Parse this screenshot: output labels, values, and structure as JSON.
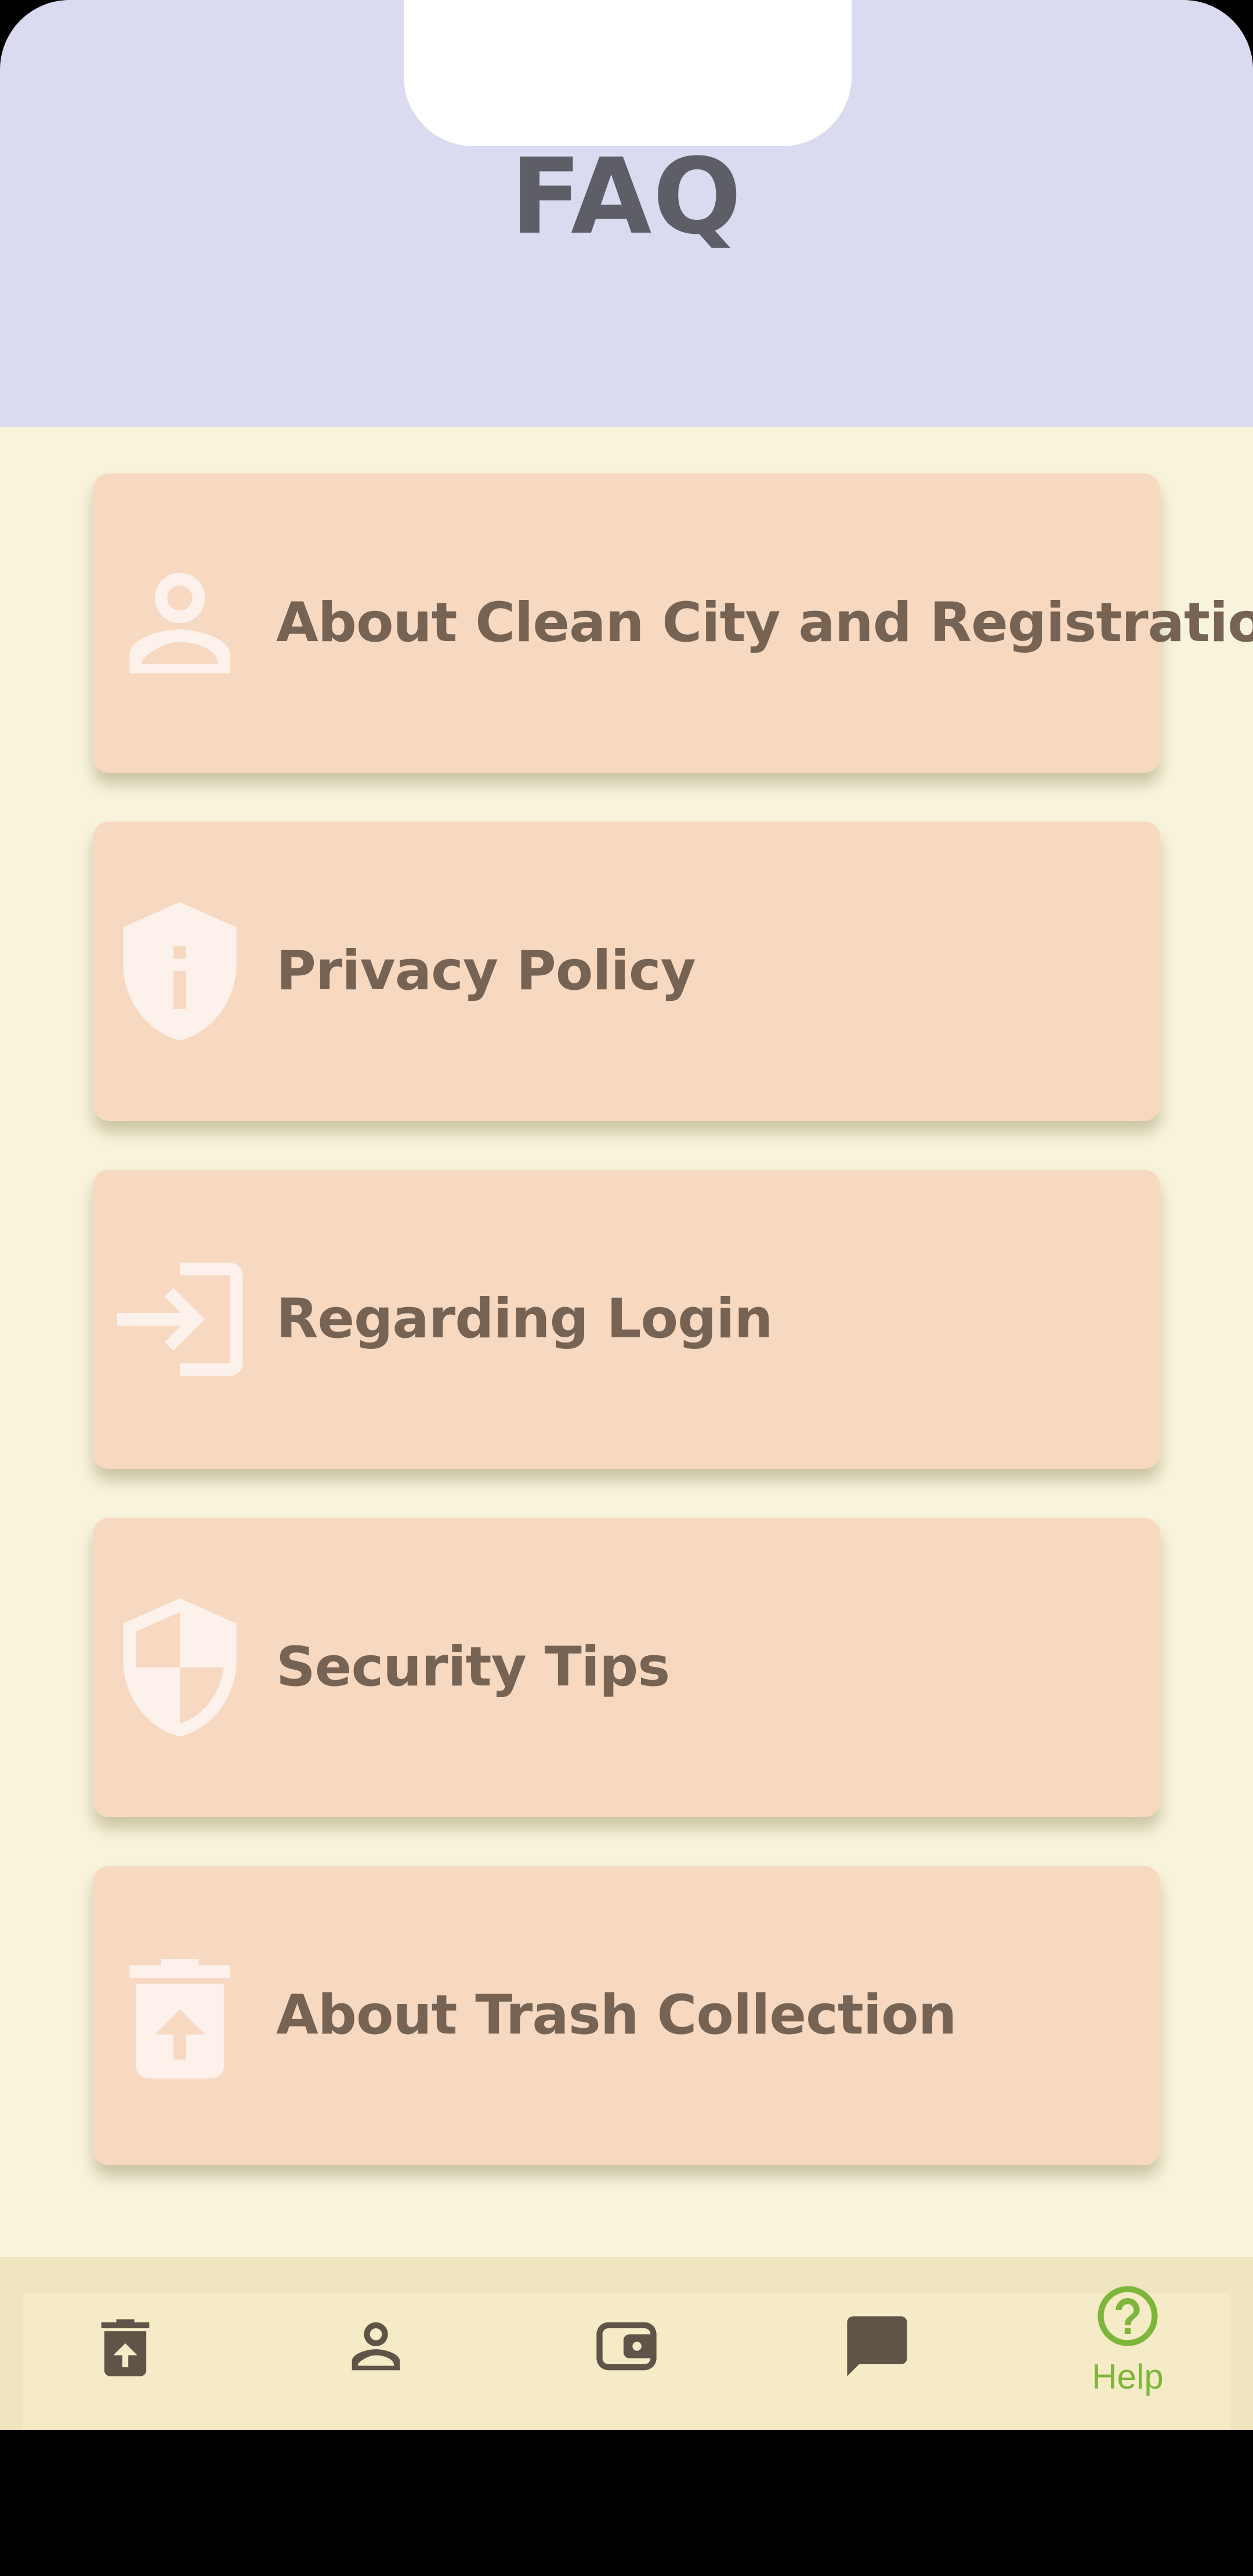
{
  "header": {
    "title": "FAQ"
  },
  "faq": {
    "items": [
      {
        "label": "About Clean City and Registration",
        "icon": "person-icon"
      },
      {
        "label": "Privacy Policy",
        "icon": "shield-info-icon"
      },
      {
        "label": "Regarding Login",
        "icon": "login-icon"
      },
      {
        "label": "Security Tips",
        "icon": "security-shield-icon"
      },
      {
        "label": "About Trash Collection",
        "icon": "trash-upload-icon"
      }
    ]
  },
  "bottom_nav": {
    "items": [
      {
        "icon": "trash-upload-icon",
        "label": ""
      },
      {
        "icon": "person-icon",
        "label": ""
      },
      {
        "icon": "wallet-icon",
        "label": ""
      },
      {
        "icon": "chat-icon",
        "label": ""
      },
      {
        "icon": "help-icon",
        "label": "Help",
        "active": true
      }
    ]
  },
  "colors": {
    "header_bg": "#dadbf0",
    "content_bg": "#f8f4dc",
    "card_bg": "#f7d8c0",
    "card_text": "#766353",
    "title_text": "#5e5f66",
    "nav_bg": "#efe5bf",
    "nav_icon": "#5f5448",
    "nav_active": "#7db63b"
  }
}
